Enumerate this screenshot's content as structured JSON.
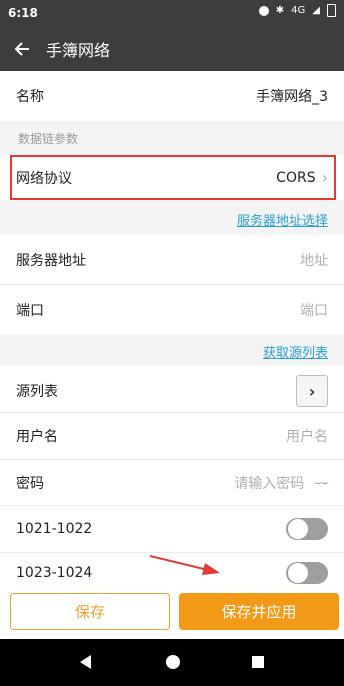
{
  "status_bar": {
    "time": "6:18",
    "network": "4G"
  },
  "app_bar": {
    "title": "手簿网络"
  },
  "fields": {
    "name": {
      "label": "名称",
      "value": "手簿网络_3"
    },
    "section_title": "数据链参数",
    "protocol": {
      "label": "网络协议",
      "value": "CORS"
    },
    "server_select_link": "服务器地址选择",
    "server_address": {
      "label": "服务器地址",
      "placeholder": "地址"
    },
    "port": {
      "label": "端口",
      "placeholder": "端口"
    },
    "get_source_link": "获取源列表",
    "source_list": {
      "label": "源列表"
    },
    "username": {
      "label": "用户名",
      "placeholder": "用户名"
    },
    "password": {
      "label": "密码",
      "placeholder": "请输入密码"
    },
    "toggle1": {
      "label": "1021-1022",
      "enabled": false
    },
    "toggle2": {
      "label": "1023-1024",
      "enabled": false
    }
  },
  "buttons": {
    "save": "保存",
    "save_apply": "保存并应用"
  },
  "colors": {
    "accent": "#f29a17",
    "link": "#2a9fd6",
    "highlight_box": "#e53935",
    "annotation_arrow": "#e53935"
  },
  "icons": [
    "back-arrow-icon",
    "chevron-right-icon",
    "arrow-right-icon",
    "eye-closed-icon",
    "nav-back-icon",
    "nav-home-icon",
    "nav-recent-icon"
  ]
}
